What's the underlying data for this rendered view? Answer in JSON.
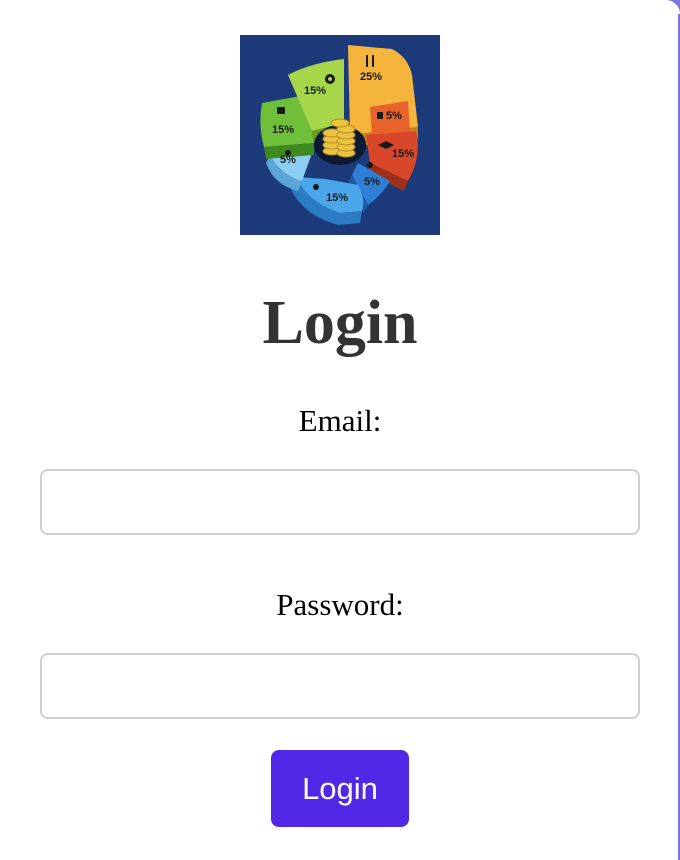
{
  "logo": {
    "icon": "budget-pie-chart-icon",
    "slices": [
      {
        "label": "25%",
        "color": "#f2a431",
        "icon": "cutlery-icon"
      },
      {
        "label": "5%",
        "color": "#e6622c",
        "icon": "receipt-icon"
      },
      {
        "label": "15%",
        "color": "#d9472a",
        "icon": "graduation-cap-icon"
      },
      {
        "label": "5%",
        "color": "#2f7fd6",
        "icon": "wifi-icon"
      },
      {
        "label": "15%",
        "color": "#4aa6e8",
        "icon": "traveler-icon"
      },
      {
        "label": "5%",
        "color": "#7fc3f2",
        "icon": "piggy-bank-icon"
      },
      {
        "label": "15%",
        "color": "#6fbf3a",
        "icon": "factory-icon"
      },
      {
        "label": "15%",
        "color": "#9fd04a",
        "icon": "film-reel-icon"
      }
    ],
    "background": "#1d3b7a"
  },
  "heading": "Login",
  "form": {
    "email_label": "Email:",
    "email_value": "",
    "email_placeholder": "",
    "password_label": "Password:",
    "password_value": "",
    "password_placeholder": "",
    "submit_label": "Login"
  },
  "colors": {
    "accent": "#5128e6",
    "border": "#cfcfcf",
    "heading": "#333333"
  }
}
